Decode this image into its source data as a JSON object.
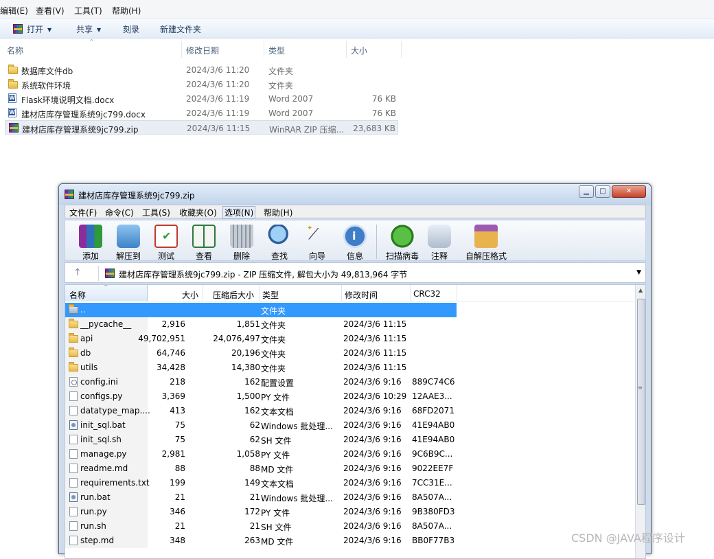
{
  "explorer": {
    "menu": [
      "编辑(E)",
      "查看(V)",
      "工具(T)",
      "帮助(H)"
    ],
    "toolbar": {
      "open": "打开",
      "share": "共享",
      "burn": "刻录",
      "new_folder": "新建文件夹"
    },
    "columns": {
      "name": "名称",
      "modified": "修改日期",
      "type": "类型",
      "size": "大小"
    },
    "files": [
      {
        "name": "数据库文件db",
        "date": "2024/3/6 11:20",
        "type": "文件夹",
        "size": "",
        "icon": "folder-icon"
      },
      {
        "name": "系统软件环境",
        "date": "2024/3/6 11:20",
        "type": "文件夹",
        "size": "",
        "icon": "folder-icon"
      },
      {
        "name": "Flask环境说明文档.docx",
        "date": "2024/3/6 11:19",
        "type": "Word 2007",
        "size": "76 KB",
        "icon": "word-doc-icon"
      },
      {
        "name": "建材店库存管理系统9jc799.docx",
        "date": "2024/3/6 11:19",
        "type": "Word 2007",
        "size": "76 KB",
        "icon": "word-doc-icon"
      },
      {
        "name": "建材店库存管理系统9jc799.zip",
        "date": "2024/3/6 11:15",
        "type": "WinRAR ZIP 压缩...",
        "size": "23,683 KB",
        "icon": "winrar-zip-icon"
      }
    ]
  },
  "winrar": {
    "title": "建材店库存管理系统9jc799.zip",
    "window_buttons": [
      "minimize",
      "maximize",
      "close"
    ],
    "menu": [
      "文件(F)",
      "命令(C)",
      "工具(S)",
      "收藏夹(O)",
      "选项(N)",
      "帮助(H)"
    ],
    "tools": [
      "添加",
      "解压到",
      "测试",
      "查看",
      "删除",
      "查找",
      "向导",
      "信息",
      "扫描病毒",
      "注释",
      "自解压格式"
    ],
    "address": "建材店库存管理系统9jc799.zip - ZIP 压缩文件, 解包大小为 49,813,964 字节",
    "columns": {
      "name": "名称",
      "size": "大小",
      "packed": "压缩后大小",
      "type": "类型",
      "modified": "修改时间",
      "crc": "CRC32"
    },
    "rows": [
      {
        "name": "..",
        "size": "",
        "packed": "",
        "type": "文件夹",
        "date": "",
        "crc": "",
        "kind": "up"
      },
      {
        "name": "__pycache__",
        "size": "2,916",
        "packed": "1,851",
        "type": "文件夹",
        "date": "2024/3/6 11:15",
        "crc": "",
        "kind": "folder"
      },
      {
        "name": "api",
        "size": "49,702,951",
        "packed": "24,076,497",
        "type": "文件夹",
        "date": "2024/3/6 11:15",
        "crc": "",
        "kind": "folder"
      },
      {
        "name": "db",
        "size": "64,746",
        "packed": "20,196",
        "type": "文件夹",
        "date": "2024/3/6 11:15",
        "crc": "",
        "kind": "folder"
      },
      {
        "name": "utils",
        "size": "34,428",
        "packed": "14,380",
        "type": "文件夹",
        "date": "2024/3/6 11:15",
        "crc": "",
        "kind": "folder"
      },
      {
        "name": "config.ini",
        "size": "218",
        "packed": "162",
        "type": "配置设置",
        "date": "2024/3/6 9:16",
        "crc": "889C74C6",
        "kind": "cfg"
      },
      {
        "name": "configs.py",
        "size": "3,369",
        "packed": "1,500",
        "type": "PY 文件",
        "date": "2024/3/6 10:29",
        "crc": "12AAE3...",
        "kind": "file"
      },
      {
        "name": "datatype_map....",
        "size": "413",
        "packed": "162",
        "type": "文本文档",
        "date": "2024/3/6 9:16",
        "crc": "68FD2071",
        "kind": "file"
      },
      {
        "name": "init_sql.bat",
        "size": "75",
        "packed": "62",
        "type": "Windows 批处理...",
        "date": "2024/3/6 9:16",
        "crc": "41E94AB0",
        "kind": "bat"
      },
      {
        "name": "init_sql.sh",
        "size": "75",
        "packed": "62",
        "type": "SH 文件",
        "date": "2024/3/6 9:16",
        "crc": "41E94AB0",
        "kind": "file"
      },
      {
        "name": "manage.py",
        "size": "2,981",
        "packed": "1,058",
        "type": "PY 文件",
        "date": "2024/3/6 9:16",
        "crc": "9C6B9C...",
        "kind": "file"
      },
      {
        "name": "readme.md",
        "size": "88",
        "packed": "88",
        "type": "MD 文件",
        "date": "2024/3/6 9:16",
        "crc": "9022EE7F",
        "kind": "file"
      },
      {
        "name": "requirements.txt",
        "size": "199",
        "packed": "149",
        "type": "文本文档",
        "date": "2024/3/6 9:16",
        "crc": "7CC31E...",
        "kind": "file"
      },
      {
        "name": "run.bat",
        "size": "21",
        "packed": "21",
        "type": "Windows 批处理...",
        "date": "2024/3/6 9:16",
        "crc": "8A507A...",
        "kind": "bat"
      },
      {
        "name": "run.py",
        "size": "346",
        "packed": "172",
        "type": "PY 文件",
        "date": "2024/3/6 9:16",
        "crc": "9B380FD3",
        "kind": "file"
      },
      {
        "name": "run.sh",
        "size": "21",
        "packed": "21",
        "type": "SH 文件",
        "date": "2024/3/6 9:16",
        "crc": "8A507A...",
        "kind": "file"
      },
      {
        "name": "step.md",
        "size": "348",
        "packed": "263",
        "type": "MD 文件",
        "date": "2024/3/6 9:16",
        "crc": "BB0F77B3",
        "kind": "file"
      }
    ]
  },
  "watermark": "CSDN @JAVA程序设计"
}
